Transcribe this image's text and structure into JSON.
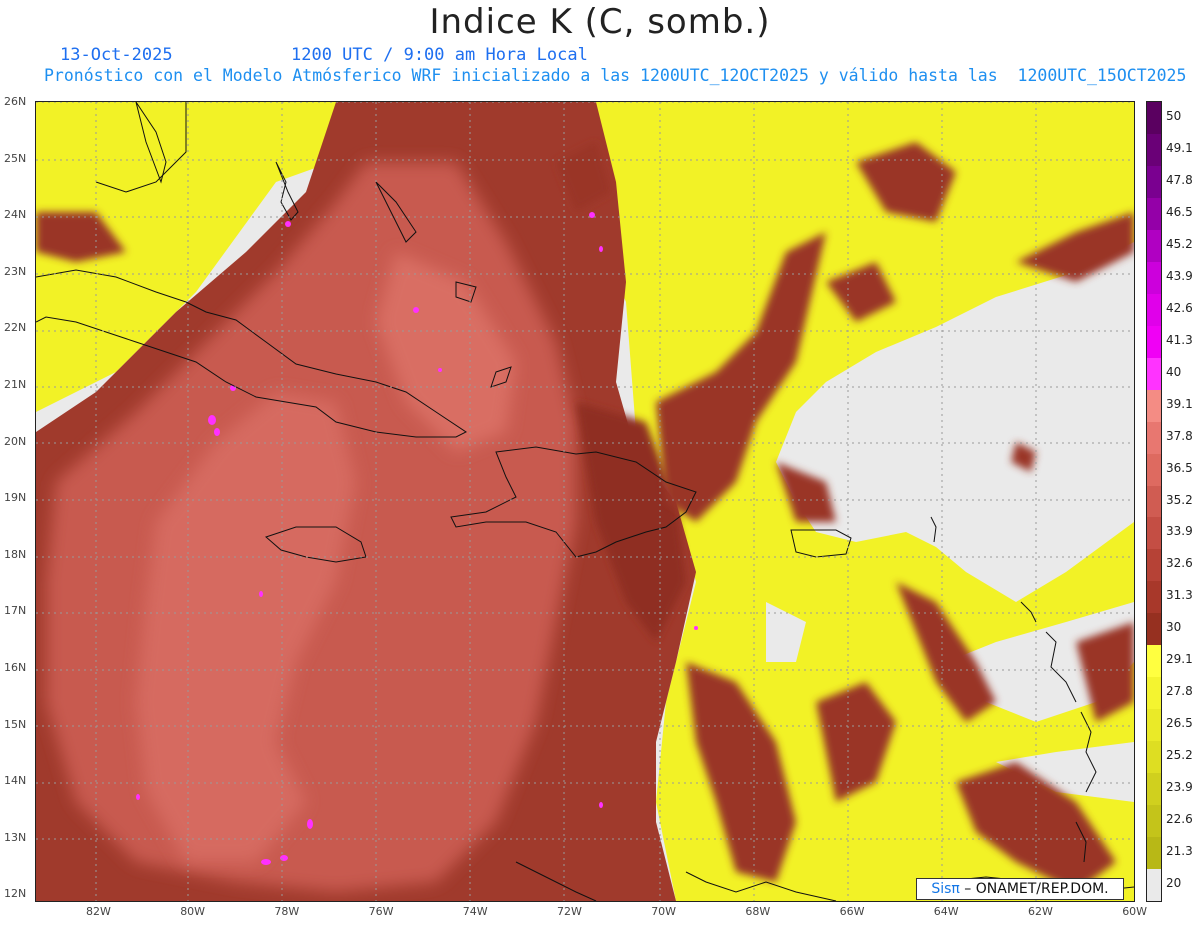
{
  "header": {
    "title": "Indice K (C, somb.)",
    "date": "13-Oct-2025",
    "time": "1200 UTC / 9:00 am Hora Local",
    "forecast_line": "Pronóstico con el Modelo Atmósferico WRF inicializado a las 1200UTC_12OCT2025 y válido hasta las  1200UTC_15OCT2025",
    "subtitle_color": "#1e6ff0"
  },
  "map": {
    "lon_range": [
      -83.2,
      -60.0
    ],
    "lat_range": [
      11.9,
      26.1
    ],
    "lat_labels": [
      "26N",
      "25N",
      "24N",
      "23N",
      "22N",
      "21N",
      "20N",
      "19N",
      "18N",
      "17N",
      "16N",
      "15N",
      "14N",
      "13N",
      "12N"
    ],
    "lon_labels": [
      "82W",
      "80W",
      "78W",
      "76W",
      "74W",
      "72W",
      "70W",
      "68W",
      "66W",
      "64W",
      "62W",
      "60W"
    ],
    "no_data_color": "#eaeaea"
  },
  "colorbar": {
    "labels": [
      "50",
      "49.1",
      "47.8",
      "46.5",
      "45.2",
      "43.9",
      "42.6",
      "41.3",
      "40",
      "39.1",
      "37.8",
      "36.5",
      "35.2",
      "33.9",
      "32.6",
      "31.3",
      "30",
      "29.1",
      "27.8",
      "26.5",
      "25.2",
      "23.9",
      "22.6",
      "21.3",
      "20"
    ],
    "colors": [
      "#5a0060",
      "#6a0077",
      "#7a0090",
      "#9400a8",
      "#b000c2",
      "#cc00dc",
      "#e000ea",
      "#f000f5",
      "#ff33ff",
      "#f48c84",
      "#e87770",
      "#de6a60",
      "#d05c52",
      "#c44e44",
      "#b64236",
      "#a8382a",
      "#963020",
      "#ffff40",
      "#f4f430",
      "#eaea28",
      "#dede22",
      "#d0d01e",
      "#c4c41a",
      "#b8b816",
      "#eaeaea"
    ]
  },
  "credit": {
    "brand": "Sisπ",
    "text": " –  ONAMET/REP.DOM."
  }
}
